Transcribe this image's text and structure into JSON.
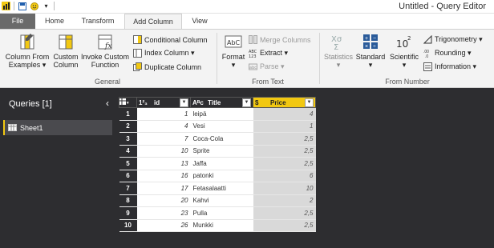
{
  "window": {
    "title": "Untitled - Query Editor"
  },
  "tabs": [
    {
      "label": "File"
    },
    {
      "label": "Home"
    },
    {
      "label": "Transform"
    },
    {
      "label": "Add Column"
    },
    {
      "label": "View"
    }
  ],
  "active_tab": "Add Column",
  "ribbon": {
    "general": {
      "label": "General",
      "column_from_examples": "Column From Examples ▾",
      "custom_column": "Custom Column",
      "invoke_custom_function": "Invoke Custom Function",
      "conditional_column": "Conditional Column",
      "index_column": "Index Column ▾",
      "duplicate_column": "Duplicate Column"
    },
    "from_text": {
      "label": "From Text",
      "format": "Format",
      "merge_columns": "Merge Columns",
      "extract": "Extract ▾",
      "parse": "Parse ▾"
    },
    "from_number": {
      "label": "From Number",
      "statistics": "Statistics",
      "standard": "Standard",
      "scientific": "Scientific",
      "trigonometry": "Trigonometry ▾",
      "rounding": "Rounding ▾",
      "information": "Information ▾"
    }
  },
  "queries_pane": {
    "title": "Queries [1]",
    "collapse_glyph": "‹",
    "items": [
      {
        "label": "Sheet1"
      }
    ]
  },
  "grid": {
    "columns": [
      {
        "type_label": "1²₃",
        "name": "id"
      },
      {
        "type_label": "Aᴮc",
        "name": "Title"
      },
      {
        "type_label": "$",
        "name": "Price"
      }
    ],
    "rows": [
      {
        "n": "1",
        "id": "1",
        "title": "leipä",
        "price": "4"
      },
      {
        "n": "2",
        "id": "4",
        "title": "Vesi",
        "price": "1"
      },
      {
        "n": "3",
        "id": "7",
        "title": "Coca-Cola",
        "price": "2,5"
      },
      {
        "n": "4",
        "id": "10",
        "title": "Sprite",
        "price": "2,5"
      },
      {
        "n": "5",
        "id": "13",
        "title": "Jaffa",
        "price": "2,5"
      },
      {
        "n": "6",
        "id": "16",
        "title": "patonki",
        "price": "6"
      },
      {
        "n": "7",
        "id": "17",
        "title": "Fetasalaatti",
        "price": "10"
      },
      {
        "n": "8",
        "id": "20",
        "title": "Kahvi",
        "price": "2"
      },
      {
        "n": "9",
        "id": "23",
        "title": "Pulla",
        "price": "2,5"
      },
      {
        "n": "10",
        "id": "26",
        "title": "Munkki",
        "price": "2,5"
      }
    ]
  },
  "colors": {
    "accent": "#f2c811",
    "pane": "#2d2d30",
    "file_tab": "#6a6a6a"
  }
}
